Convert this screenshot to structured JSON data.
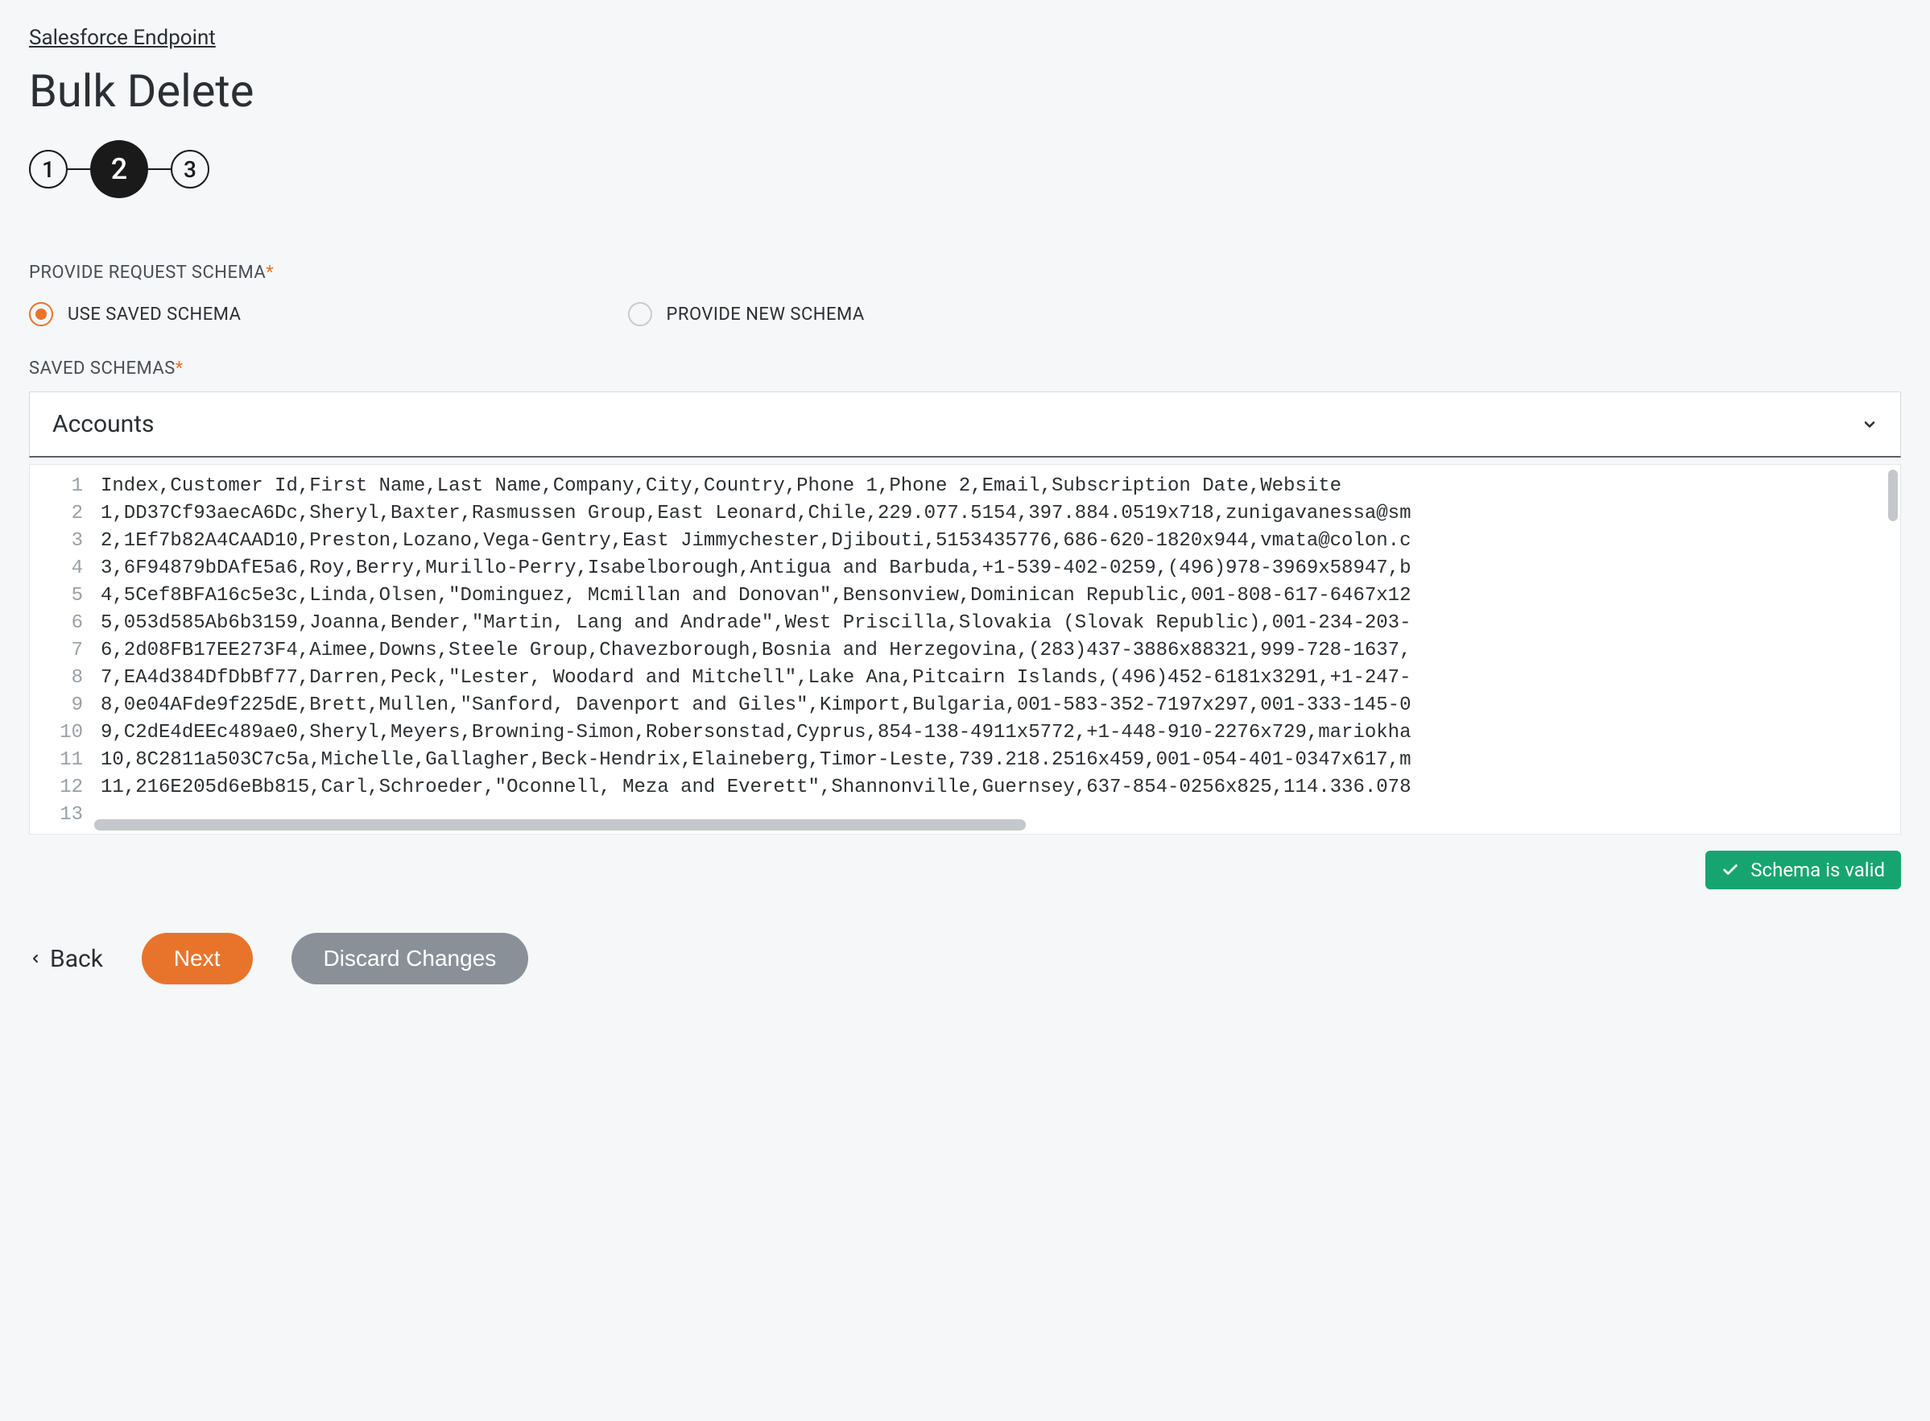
{
  "breadcrumb": "Salesforce Endpoint",
  "page_title": "Bulk Delete",
  "stepper": {
    "steps": [
      "1",
      "2",
      "3"
    ],
    "active_index": 1
  },
  "schema_section": {
    "label": "PROVIDE REQUEST SCHEMA",
    "options": {
      "use_saved": "USE SAVED SCHEMA",
      "provide_new": "PROVIDE NEW SCHEMA"
    },
    "selected": "use_saved"
  },
  "saved_schemas": {
    "label": "SAVED SCHEMAS",
    "selected": "Accounts"
  },
  "editor": {
    "lines": [
      "Index,Customer Id,First Name,Last Name,Company,City,Country,Phone 1,Phone 2,Email,Subscription Date,Website",
      "1,DD37Cf93aecA6Dc,Sheryl,Baxter,Rasmussen Group,East Leonard,Chile,229.077.5154,397.884.0519x718,zunigavanessa@sm",
      "2,1Ef7b82A4CAAD10,Preston,Lozano,Vega-Gentry,East Jimmychester,Djibouti,5153435776,686-620-1820x944,vmata@colon.c",
      "3,6F94879bDAfE5a6,Roy,Berry,Murillo-Perry,Isabelborough,Antigua and Barbuda,+1-539-402-0259,(496)978-3969x58947,b",
      "4,5Cef8BFA16c5e3c,Linda,Olsen,\"Dominguez, Mcmillan and Donovan\",Bensonview,Dominican Republic,001-808-617-6467x12",
      "5,053d585Ab6b3159,Joanna,Bender,\"Martin, Lang and Andrade\",West Priscilla,Slovakia (Slovak Republic),001-234-203-",
      "6,2d08FB17EE273F4,Aimee,Downs,Steele Group,Chavezborough,Bosnia and Herzegovina,(283)437-3886x88321,999-728-1637,",
      "7,EA4d384DfDbBf77,Darren,Peck,\"Lester, Woodard and Mitchell\",Lake Ana,Pitcairn Islands,(496)452-6181x3291,+1-247-",
      "8,0e04AFde9f225dE,Brett,Mullen,\"Sanford, Davenport and Giles\",Kimport,Bulgaria,001-583-352-7197x297,001-333-145-0",
      "9,C2dE4dEEc489ae0,Sheryl,Meyers,Browning-Simon,Robersonstad,Cyprus,854-138-4911x5772,+1-448-910-2276x729,mariokha",
      "10,8C2811a503C7c5a,Michelle,Gallagher,Beck-Hendrix,Elaineberg,Timor-Leste,739.218.2516x459,001-054-401-0347x617,m",
      "11,216E205d6eBb815,Carl,Schroeder,\"Oconnell, Meza and Everett\",Shannonville,Guernsey,637-854-0256x825,114.336.078",
      ""
    ]
  },
  "validation": {
    "message": "Schema is valid"
  },
  "footer": {
    "back": "Back",
    "next": "Next",
    "discard": "Discard Changes"
  }
}
